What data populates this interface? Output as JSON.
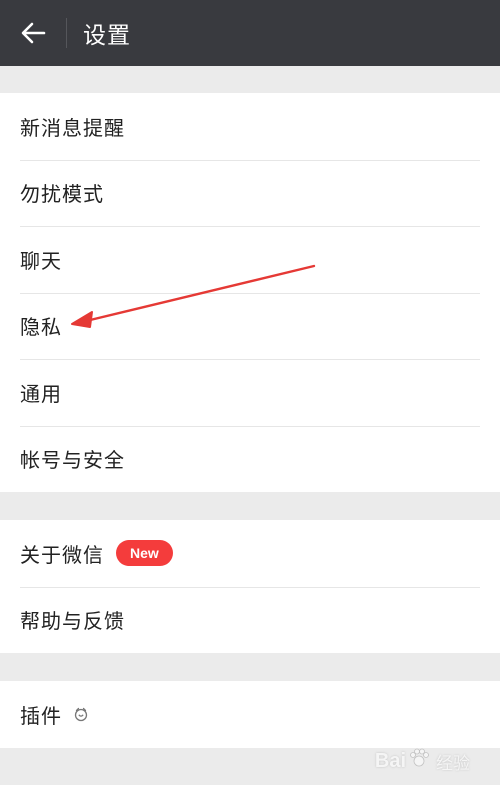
{
  "header": {
    "title": "设置",
    "back_icon": "arrow-left-icon"
  },
  "groups": [
    {
      "items": [
        {
          "label": "新消息提醒"
        },
        {
          "label": "勿扰模式"
        },
        {
          "label": "聊天"
        },
        {
          "label": "隐私"
        },
        {
          "label": "通用"
        },
        {
          "label": "帐号与安全"
        }
      ]
    },
    {
      "items": [
        {
          "label": "关于微信",
          "badge": "New"
        },
        {
          "label": "帮助与反馈"
        }
      ]
    },
    {
      "items": [
        {
          "label": "插件",
          "icon": "plugin-icon"
        }
      ]
    }
  ],
  "colors": {
    "topbar": "#393a3f",
    "background": "#ebebeb",
    "badge": "#f43c3c",
    "annotation_arrow": "#e53935"
  },
  "watermark": {
    "brand_left": "Bai",
    "brand_right": "经验",
    "brand_icon": "paw-icon"
  }
}
